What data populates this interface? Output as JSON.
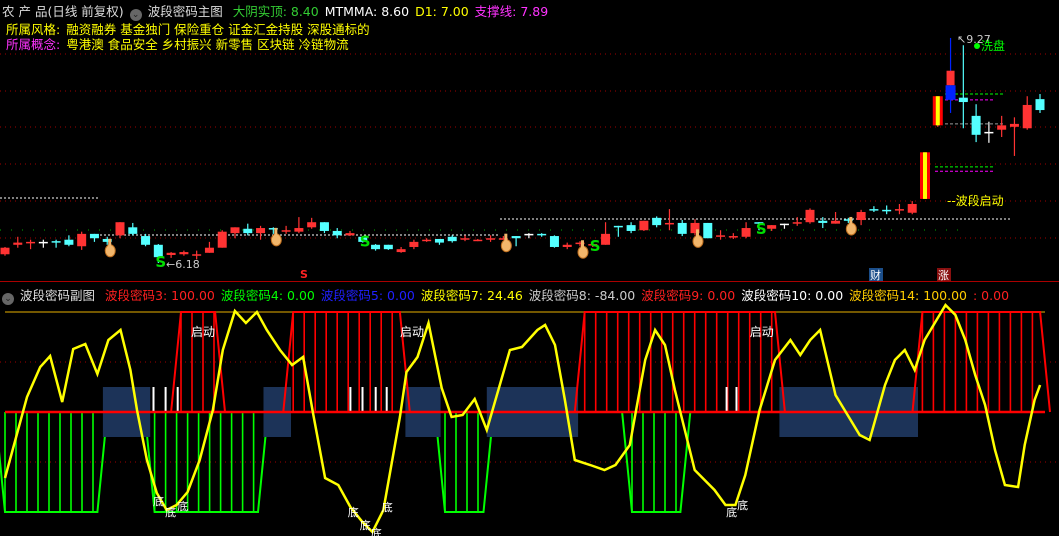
{
  "main_header": {
    "stock": "农 产 品(日线 前复权)",
    "indicator": "波段密码主图",
    "items": [
      {
        "label": "大阴实顶: 8.40",
        "color": "#33cc33"
      },
      {
        "label": "MTMMA: 8.60",
        "color": "#ffffff"
      },
      {
        "label": "D1: 7.00",
        "color": "#ffff00"
      },
      {
        "label": "支撑线: 7.89",
        "color": "#ff33ff"
      }
    ],
    "style_label": "所属风格:",
    "style_value": "融资融券 基金独门 保险重仓 证金汇金持股 深股通标的",
    "concept_label": "所属概念:",
    "concept_value": "粤港澳 食品安全 乡村振兴 新零售 区块链 冷链物流"
  },
  "sub_header": {
    "indicator": "波段密码副图",
    "items": [
      {
        "label": "波段密码3: 100.00",
        "color": "#ff2020"
      },
      {
        "label": "波段密码4: 0.00",
        "color": "#00ff00"
      },
      {
        "label": "波段密码5: 0.00",
        "color": "#2020ff"
      },
      {
        "label": "波段密码7: 24.46",
        "color": "#ffff00"
      },
      {
        "label": "波段密码8: -84.00",
        "color": "#cccccc"
      },
      {
        "label": "波段密码9: 0.00",
        "color": "#ff2020"
      },
      {
        "label": "波段密码10: 0.00",
        "color": "#ffffff"
      },
      {
        "label": "波段密码14: 100.00",
        "color": "#ffcc00"
      },
      {
        "label": ": 0.00",
        "color": "#ff2020"
      }
    ]
  },
  "annotations": {
    "low_label": "6.18",
    "high_label": "9.27",
    "wash_label": "洗盘",
    "wave_start_label": "波段启动",
    "start_label": "启动",
    "bottom_label": "底",
    "finance_badge": "财",
    "rise_badge": "涨",
    "s_marker": "S"
  },
  "colors": {
    "up": "#ff3333",
    "down": "#54ffff",
    "blue": "#0022ff",
    "yellow": "#ffff00",
    "green": "#00ff00",
    "box": "#1c3358"
  },
  "chart_data": [
    {
      "type": "candlestick",
      "title": "波段密码主图",
      "ylim": [
        6.18,
        9.27
      ],
      "ohlc": [
        [
          6.3,
          6.4,
          6.28,
          6.39
        ],
        [
          6.43,
          6.54,
          6.39,
          6.46
        ],
        [
          6.47,
          6.5,
          6.37,
          6.47
        ],
        [
          6.47,
          6.5,
          6.39,
          6.47
        ],
        [
          6.48,
          6.5,
          6.39,
          6.46
        ],
        [
          6.5,
          6.56,
          6.41,
          6.43
        ],
        [
          6.41,
          6.61,
          6.36,
          6.58
        ],
        [
          6.58,
          6.58,
          6.47,
          6.52
        ],
        [
          6.51,
          6.54,
          6.43,
          6.47
        ],
        [
          6.56,
          6.74,
          6.52,
          6.74
        ],
        [
          6.67,
          6.73,
          6.56,
          6.58
        ],
        [
          6.55,
          6.58,
          6.41,
          6.43
        ],
        [
          6.43,
          6.44,
          6.18,
          6.26
        ],
        [
          6.29,
          6.33,
          6.25,
          6.32
        ],
        [
          6.3,
          6.35,
          6.28,
          6.33
        ],
        [
          6.28,
          6.35,
          6.23,
          6.3
        ],
        [
          6.32,
          6.47,
          6.32,
          6.39
        ],
        [
          6.39,
          6.63,
          6.39,
          6.61
        ],
        [
          6.59,
          6.67,
          6.52,
          6.67
        ],
        [
          6.65,
          6.72,
          6.56,
          6.59
        ],
        [
          6.59,
          6.69,
          6.5,
          6.66
        ],
        [
          6.66,
          6.67,
          6.58,
          6.65
        ],
        [
          6.62,
          6.69,
          6.58,
          6.63
        ],
        [
          6.61,
          6.81,
          6.59,
          6.66
        ],
        [
          6.67,
          6.8,
          6.65,
          6.74
        ],
        [
          6.74,
          6.74,
          6.59,
          6.62
        ],
        [
          6.62,
          6.66,
          6.52,
          6.56
        ],
        [
          6.56,
          6.62,
          6.55,
          6.59
        ],
        [
          6.54,
          6.55,
          6.46,
          6.47
        ],
        [
          6.43,
          6.44,
          6.35,
          6.37
        ],
        [
          6.43,
          6.43,
          6.36,
          6.37
        ],
        [
          6.33,
          6.4,
          6.32,
          6.37
        ],
        [
          6.4,
          6.5,
          6.37,
          6.47
        ],
        [
          6.48,
          6.52,
          6.47,
          6.5
        ],
        [
          6.51,
          6.51,
          6.43,
          6.46
        ],
        [
          6.54,
          6.56,
          6.46,
          6.48
        ],
        [
          6.5,
          6.56,
          6.48,
          6.52
        ],
        [
          6.48,
          6.51,
          6.48,
          6.5
        ],
        [
          6.5,
          6.56,
          6.47,
          6.52
        ],
        [
          6.51,
          6.55,
          6.5,
          6.52
        ],
        [
          6.55,
          6.55,
          6.41,
          6.52
        ],
        [
          6.58,
          6.59,
          6.52,
          6.58
        ],
        [
          6.58,
          6.59,
          6.54,
          6.56
        ],
        [
          6.55,
          6.56,
          6.39,
          6.4
        ],
        [
          6.4,
          6.46,
          6.37,
          6.43
        ],
        [
          6.44,
          6.48,
          6.41,
          6.46
        ],
        [
          6.44,
          6.46,
          6.4,
          6.44
        ],
        [
          6.43,
          6.74,
          6.43,
          6.58
        ],
        [
          6.69,
          6.69,
          6.54,
          6.67
        ],
        [
          6.7,
          6.74,
          6.59,
          6.62
        ],
        [
          6.63,
          6.76,
          6.62,
          6.76
        ],
        [
          6.8,
          6.82,
          6.67,
          6.7
        ],
        [
          6.73,
          6.92,
          6.63,
          6.73
        ],
        [
          6.73,
          6.77,
          6.55,
          6.58
        ],
        [
          6.59,
          6.78,
          6.56,
          6.73
        ],
        [
          6.73,
          6.73,
          6.52,
          6.52
        ],
        [
          6.54,
          6.63,
          6.5,
          6.56
        ],
        [
          6.54,
          6.59,
          6.51,
          6.55
        ],
        [
          6.54,
          6.74,
          6.52,
          6.66
        ],
        [
          6.74,
          6.74,
          6.63,
          6.72
        ],
        [
          6.65,
          6.7,
          6.62,
          6.7
        ],
        [
          6.72,
          6.72,
          6.65,
          6.72
        ],
        [
          6.72,
          6.81,
          6.69,
          6.74
        ],
        [
          6.74,
          6.93,
          6.72,
          6.91
        ],
        [
          6.76,
          6.81,
          6.66,
          6.73
        ],
        [
          6.72,
          6.88,
          6.72,
          6.76
        ],
        [
          6.78,
          6.8,
          6.73,
          6.76
        ],
        [
          6.77,
          6.91,
          6.7,
          6.88
        ],
        [
          6.92,
          6.96,
          6.88,
          6.91
        ],
        [
          6.91,
          6.97,
          6.85,
          6.89
        ],
        [
          6.91,
          6.99,
          6.85,
          6.92
        ],
        [
          6.87,
          7.03,
          6.85,
          6.99
        ],
        [
          7.06,
          7.7,
          7.06,
          7.7
        ],
        [
          8.07,
          8.47,
          8.05,
          8.47
        ],
        [
          8.42,
          9.27,
          8.24,
          8.82
        ],
        [
          8.45,
          9.17,
          8.03,
          8.39
        ],
        [
          8.2,
          8.36,
          7.84,
          7.94
        ],
        [
          7.98,
          8.12,
          7.83,
          7.98
        ],
        [
          8.01,
          8.2,
          7.91,
          8.07
        ],
        [
          8.05,
          8.18,
          7.65,
          8.09
        ],
        [
          8.03,
          8.47,
          8.01,
          8.35
        ],
        [
          8.43,
          8.5,
          8.24,
          8.28
        ]
      ],
      "special_bars": {
        "signal": [
          72,
          73
        ],
        "blue": [
          74
        ]
      },
      "hand_markers": [
        8,
        21,
        39,
        45,
        54,
        66
      ],
      "s_markers": [
        12,
        28,
        46,
        59
      ],
      "levels": {
        "green": 8.5,
        "magenta": 8.42,
        "grey": 8.09,
        "green_low": 7.5,
        "magenta_low": 7.44
      }
    },
    {
      "type": "line",
      "title": "波段密码副图",
      "ylim": [
        -125,
        110
      ],
      "reference_lines": [
        100,
        50,
        0,
        -50
      ],
      "yellow_series": [
        [
          0,
          -66
        ],
        [
          2,
          15
        ],
        [
          3.2,
          45
        ],
        [
          4.1,
          56
        ],
        [
          5.2,
          10
        ],
        [
          6.2,
          63
        ],
        [
          7.3,
          68
        ],
        [
          8.4,
          38
        ],
        [
          9.4,
          72
        ],
        [
          10.5,
          82
        ],
        [
          11.4,
          42
        ],
        [
          12,
          2
        ],
        [
          12.9,
          -48
        ],
        [
          13.8,
          -81
        ],
        [
          14.7,
          -98
        ],
        [
          15.6,
          -93
        ],
        [
          16.6,
          -80
        ],
        [
          17.7,
          -48
        ],
        [
          18.9,
          2
        ],
        [
          19.8,
          62
        ],
        [
          20.9,
          101
        ],
        [
          21.9,
          89
        ],
        [
          22.9,
          100
        ],
        [
          23.8,
          82
        ],
        [
          25,
          62
        ],
        [
          26.1,
          47
        ],
        [
          27.1,
          55
        ],
        [
          28,
          -1
        ],
        [
          29.1,
          -66
        ],
        [
          30.3,
          -73
        ],
        [
          31.4,
          -95
        ],
        [
          32.5,
          -110
        ],
        [
          33.4,
          -120
        ],
        [
          34.4,
          -98
        ],
        [
          35.9,
          -5
        ],
        [
          36.5,
          40
        ],
        [
          37.5,
          55
        ],
        [
          38.5,
          89
        ],
        [
          39.7,
          24
        ],
        [
          40.6,
          -5
        ],
        [
          41.6,
          -3
        ],
        [
          42.7,
          13
        ],
        [
          43.8,
          -18
        ],
        [
          45.9,
          62
        ],
        [
          47,
          65
        ],
        [
          48.4,
          82
        ],
        [
          49.1,
          87
        ],
        [
          50,
          67
        ],
        [
          50.9,
          12
        ],
        [
          51.8,
          -48
        ],
        [
          53.2,
          -53
        ],
        [
          54.5,
          -58
        ],
        [
          55.5,
          -53
        ],
        [
          56.8,
          -33
        ],
        [
          58.2,
          52
        ],
        [
          59.1,
          82
        ],
        [
          60,
          67
        ],
        [
          60.9,
          22
        ],
        [
          61.8,
          -18
        ],
        [
          62.7,
          -58
        ],
        [
          63.6,
          -68
        ],
        [
          64.5,
          -78
        ],
        [
          65.5,
          -93
        ],
        [
          66.4,
          -93
        ],
        [
          67.3,
          -63
        ],
        [
          68.6,
          2
        ],
        [
          70,
          52
        ],
        [
          71.4,
          72
        ],
        [
          72.3,
          57
        ],
        [
          73.2,
          72
        ],
        [
          74.1,
          82
        ],
        [
          75.5,
          17
        ],
        [
          76.6,
          -3
        ],
        [
          77.7,
          -23
        ],
        [
          78.6,
          -28
        ],
        [
          80,
          27
        ],
        [
          80.9,
          52
        ],
        [
          81.8,
          62
        ],
        [
          82.7,
          42
        ],
        [
          83.6,
          72
        ],
        [
          85.5,
          107
        ],
        [
          86.4,
          97
        ],
        [
          87.3,
          72
        ],
        [
          88.2,
          37
        ],
        [
          89.1,
          7
        ],
        [
          90,
          -38
        ],
        [
          90.9,
          -73
        ],
        [
          92.1,
          -75
        ],
        [
          92.7,
          -33
        ],
        [
          93.6,
          12
        ],
        [
          94.1,
          27
        ]
      ],
      "red_zones": [
        [
          16,
          19.1,
          100
        ],
        [
          26.2,
          35.9,
          100
        ],
        [
          52.7,
          70,
          100
        ],
        [
          83.4,
          94.1,
          100
        ]
      ],
      "green_zones": [
        [
          0,
          8.4,
          -100
        ],
        [
          13.6,
          23,
          -100
        ],
        [
          40,
          43.5,
          -100
        ],
        [
          57,
          61.4,
          -100
        ]
      ],
      "blue_boxes": [
        [
          8.9,
          13.2,
          25,
          -25
        ],
        [
          23.5,
          26,
          25,
          -25
        ],
        [
          36.4,
          39.6,
          25,
          -25
        ],
        [
          43.8,
          52.1,
          25,
          -25
        ],
        [
          70.4,
          83,
          25,
          -25
        ]
      ],
      "white_bars": [
        [
          13.5,
          25
        ],
        [
          14.6,
          25
        ],
        [
          15.7,
          25
        ],
        [
          31.4,
          25
        ],
        [
          32.5,
          25
        ],
        [
          33.7,
          25
        ],
        [
          34.7,
          25
        ],
        [
          65.6,
          25
        ],
        [
          66.5,
          25
        ]
      ],
      "start_labels": [
        [
          18,
          80
        ],
        [
          37,
          80
        ],
        [
          68.8,
          80
        ]
      ],
      "bottom_labels": [
        [
          14,
          -87
        ],
        [
          15.1,
          -98
        ],
        [
          16.2,
          -92
        ],
        [
          31.7,
          -98
        ],
        [
          32.8,
          -111
        ],
        [
          33.8,
          -119
        ],
        [
          34.8,
          -93
        ],
        [
          66.1,
          -98
        ],
        [
          67.1,
          -91
        ]
      ]
    }
  ]
}
